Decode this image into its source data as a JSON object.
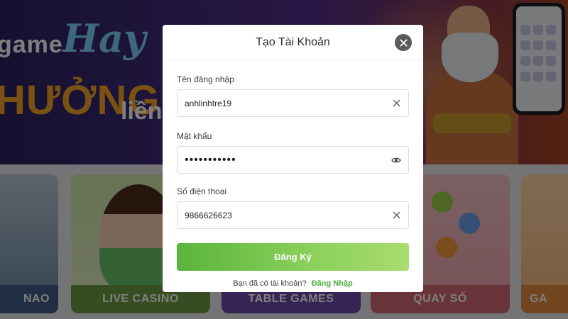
{
  "background": {
    "banner": {
      "line1": "game",
      "line_hay": "Hay",
      "line2": "HƯỞNG",
      "line3": "liền"
    },
    "categories": [
      {
        "label": "NAO"
      },
      {
        "label": "LIVE CASINO"
      },
      {
        "label": "TABLE GAMES"
      },
      {
        "label": "QUAY SỐ"
      },
      {
        "label": "GA"
      }
    ]
  },
  "modal": {
    "title": "Tạo Tài Khoản",
    "close_icon": "close-icon",
    "fields": {
      "username": {
        "label": "Tên đăng nhập",
        "value": "anhlinhtre19",
        "icon": "clear-icon"
      },
      "password": {
        "label": "Mật khẩu",
        "value": "•••••••••••",
        "icon": "eye-icon"
      },
      "phone": {
        "label": "Số điện thoại",
        "value": "9866626623",
        "icon": "clear-icon"
      }
    },
    "submit_label": "Đăng Ký",
    "login_prompt": "Bạn đã có tài khoản?",
    "login_link": "Đăng Nhập"
  },
  "colors": {
    "accent_green": "#5ab43e",
    "link_green": "#4fae39",
    "close_bg": "#5a5a5a"
  }
}
